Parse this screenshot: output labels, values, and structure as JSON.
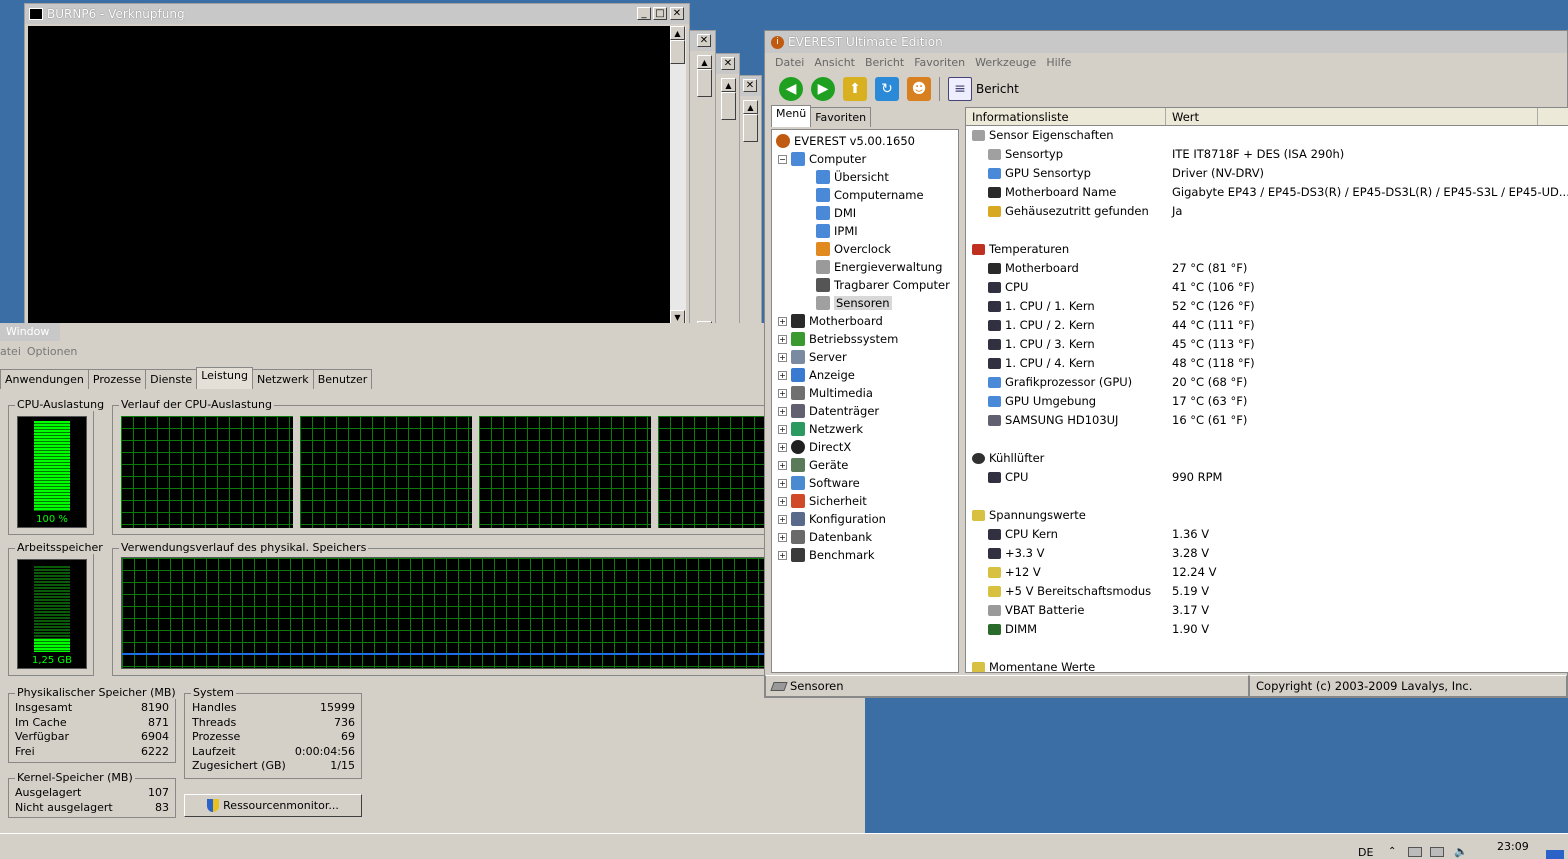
{
  "console": {
    "title": "BURNP6 - Verknüpfung"
  },
  "taskmgr": {
    "title": "Window",
    "menu": [
      "atei",
      "Optionen"
    ],
    "tabs": [
      "Anwendungen",
      "Prozesse",
      "Dienste",
      "Leistung",
      "Netzwerk",
      "Benutzer"
    ],
    "active_tab": "Leistung",
    "cpu_usage_label": "CPU-Auslastung",
    "cpu_usage_value": "100 %",
    "cpu_usage_fraction": 1.0,
    "cpu_history_label": "Verlauf der CPU-Auslastung",
    "mem_label": "Arbeitsspeicher",
    "mem_value": "1,25 GB",
    "mem_fraction": 0.15,
    "mem_history_label": "Verwendungsverlauf des physikal. Speichers",
    "physical": {
      "label": "Physikalischer Speicher (MB)",
      "rows": [
        {
          "k": "Insgesamt",
          "v": "8190"
        },
        {
          "k": "Im Cache",
          "v": "871"
        },
        {
          "k": "Verfügbar",
          "v": "6904"
        },
        {
          "k": "Frei",
          "v": "6222"
        }
      ]
    },
    "system": {
      "label": "System",
      "rows": [
        {
          "k": "Handles",
          "v": "15999"
        },
        {
          "k": "Threads",
          "v": "736"
        },
        {
          "k": "Prozesse",
          "v": "69"
        },
        {
          "k": "Laufzeit",
          "v": "0:00:04:56"
        },
        {
          "k": "Zugesichert (GB)",
          "v": "1/15"
        }
      ]
    },
    "kernel": {
      "label": "Kernel-Speicher (MB)",
      "rows": [
        {
          "k": "Ausgelagert",
          "v": "107"
        },
        {
          "k": "Nicht ausgelagert",
          "v": "83"
        }
      ]
    },
    "resource_button": "Ressourcenmonitor..."
  },
  "everest": {
    "title": "EVEREST Ultimate Edition",
    "menu": [
      "Datei",
      "Ansicht",
      "Bericht",
      "Favoriten",
      "Werkzeuge",
      "Hilfe"
    ],
    "report_label": "Bericht",
    "tabs": [
      "Menü",
      "Favoriten"
    ],
    "tree": [
      {
        "label": "EVEREST v5.00.1650",
        "level": 0,
        "icon": "info-icon"
      },
      {
        "label": "Computer",
        "level": 1,
        "icon": "computer-icon",
        "exp": "−"
      },
      {
        "label": "Übersicht",
        "level": 2,
        "icon": "computer-icon"
      },
      {
        "label": "Computername",
        "level": 2,
        "icon": "computer-icon"
      },
      {
        "label": "DMI",
        "level": 2,
        "icon": "computer-icon"
      },
      {
        "label": "IPMI",
        "level": 2,
        "icon": "computer-icon"
      },
      {
        "label": "Overclock",
        "level": 2,
        "icon": "flame-icon"
      },
      {
        "label": "Energieverwaltung",
        "level": 2,
        "icon": "power-icon"
      },
      {
        "label": "Tragbarer Computer",
        "level": 2,
        "icon": "laptop-icon"
      },
      {
        "label": "Sensoren",
        "level": 2,
        "icon": "sensor-icon",
        "selected": true
      },
      {
        "label": "Motherboard",
        "level": 1,
        "icon": "motherboard-icon",
        "exp": "+"
      },
      {
        "label": "Betriebssystem",
        "level": 1,
        "icon": "windows-icon",
        "exp": "+"
      },
      {
        "label": "Server",
        "level": 1,
        "icon": "server-icon",
        "exp": "+"
      },
      {
        "label": "Anzeige",
        "level": 1,
        "icon": "monitor-icon",
        "exp": "+"
      },
      {
        "label": "Multimedia",
        "level": 1,
        "icon": "speaker-icon",
        "exp": "+"
      },
      {
        "label": "Datenträger",
        "level": 1,
        "icon": "disk-icon",
        "exp": "+"
      },
      {
        "label": "Netzwerk",
        "level": 1,
        "icon": "globe-icon",
        "exp": "+"
      },
      {
        "label": "DirectX",
        "level": 1,
        "icon": "directx-icon",
        "exp": "+"
      },
      {
        "label": "Geräte",
        "level": 1,
        "icon": "device-icon",
        "exp": "+"
      },
      {
        "label": "Software",
        "level": 1,
        "icon": "software-icon",
        "exp": "+"
      },
      {
        "label": "Sicherheit",
        "level": 1,
        "icon": "shield-icon",
        "exp": "+"
      },
      {
        "label": "Konfiguration",
        "level": 1,
        "icon": "config-icon",
        "exp": "+"
      },
      {
        "label": "Datenbank",
        "level": 1,
        "icon": "database-icon",
        "exp": "+"
      },
      {
        "label": "Benchmark",
        "level": 1,
        "icon": "hourglass-icon",
        "exp": "+"
      }
    ],
    "columns": [
      "Informationsliste",
      "Wert"
    ],
    "rows": [
      {
        "type": "section",
        "label": "Sensor Eigenschaften",
        "icon": "sensor-icon"
      },
      {
        "label": "Sensortyp",
        "value": "ITE IT8718F + DES  (ISA 290h)",
        "icon": "sensor-icon"
      },
      {
        "label": "GPU Sensortyp",
        "value": "Driver  (NV-DRV)",
        "icon": "computer-icon"
      },
      {
        "label": "Motherboard Name",
        "value": "Gigabyte EP43 / EP45-DS3(R) / EP45-DS3L(R) / EP45-S3L /  EP45-UD...",
        "icon": "motherboard-icon"
      },
      {
        "label": "Gehäusezutritt gefunden",
        "value": "Ja",
        "icon": "lock-icon"
      },
      {
        "type": "blank"
      },
      {
        "type": "section",
        "label": "Temperaturen",
        "icon": "thermometer-icon"
      },
      {
        "label": "Motherboard",
        "value": "27 °C  (81 °F)",
        "icon": "motherboard-icon"
      },
      {
        "label": "CPU",
        "value": "41 °C  (106 °F)",
        "icon": "chip-icon"
      },
      {
        "label": "1. CPU / 1. Kern",
        "value": "52 °C  (126 °F)",
        "icon": "chip-icon"
      },
      {
        "label": "1. CPU / 2. Kern",
        "value": "44 °C  (111 °F)",
        "icon": "chip-icon"
      },
      {
        "label": "1. CPU / 3. Kern",
        "value": "45 °C  (113 °F)",
        "icon": "chip-icon"
      },
      {
        "label": "1. CPU / 4. Kern",
        "value": "48 °C  (118 °F)",
        "icon": "chip-icon"
      },
      {
        "label": "Grafikprozessor (GPU)",
        "value": "20 °C  (68 °F)",
        "icon": "computer-icon"
      },
      {
        "label": "GPU Umgebung",
        "value": "17 °C  (63 °F)",
        "icon": "computer-icon"
      },
      {
        "label": "SAMSUNG HD103UJ",
        "value": "16 °C  (61 °F)",
        "icon": "disk-icon"
      },
      {
        "type": "blank"
      },
      {
        "type": "section",
        "label": "Kühllüfter",
        "icon": "fan-icon"
      },
      {
        "label": "CPU",
        "value": "990 RPM",
        "icon": "chip-icon"
      },
      {
        "type": "blank"
      },
      {
        "type": "section",
        "label": "Spannungswerte",
        "icon": "warning-icon"
      },
      {
        "label": "CPU Kern",
        "value": "1.36 V",
        "icon": "chip-icon"
      },
      {
        "label": "+3.3 V",
        "value": "3.28 V",
        "icon": "chip-icon"
      },
      {
        "label": "+12 V",
        "value": "12.24 V",
        "icon": "warning-icon"
      },
      {
        "label": "+5 V Bereitschaftsmodus",
        "value": "5.19 V",
        "icon": "warning-icon"
      },
      {
        "label": "VBAT Batterie",
        "value": "3.17 V",
        "icon": "power-icon"
      },
      {
        "label": "DIMM",
        "value": "1.90 V",
        "icon": "ram-icon"
      },
      {
        "type": "blank"
      },
      {
        "type": "section",
        "label": "Momentane Werte",
        "icon": "warning-icon"
      }
    ],
    "status_left": "Sensoren",
    "status_right": "Copyright (c) 2003-2009 Lavalys, Inc."
  },
  "taskbar": {
    "lang": "DE",
    "clock": "23:09"
  },
  "colors": {
    "desktop": "#3a6ea5",
    "meter_green": "#00ff00",
    "grid_green": "#0a7a0a",
    "mem_line": "#1e6ee8"
  }
}
